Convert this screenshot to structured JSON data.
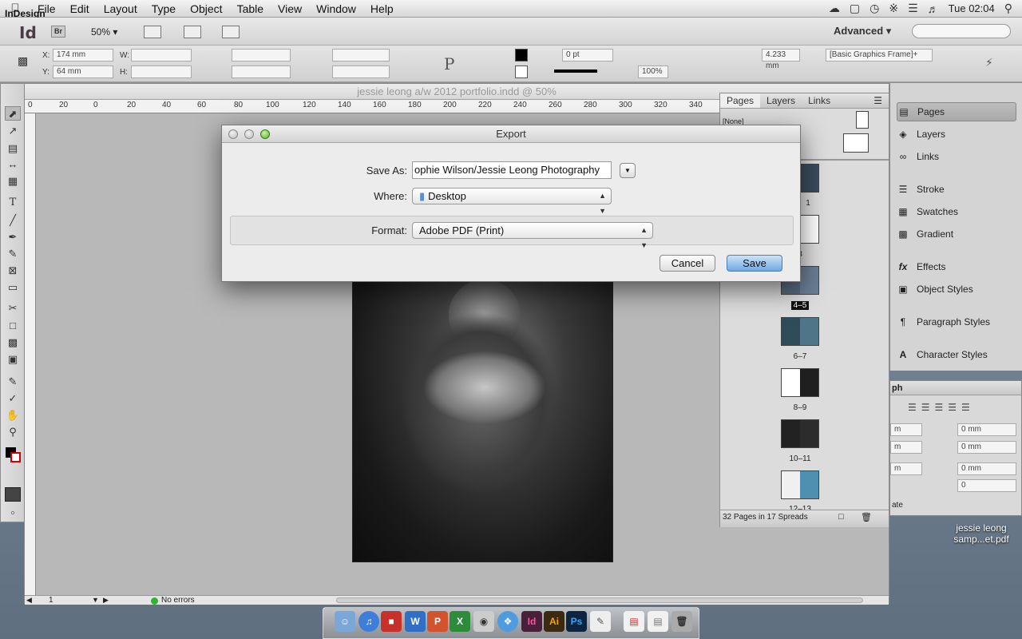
{
  "menubar": {
    "app_name": "InDesign",
    "menus": [
      "File",
      "Edit",
      "Layout",
      "Type",
      "Object",
      "Table",
      "View",
      "Window",
      "Help"
    ],
    "clock": "Tue 02:04"
  },
  "appbar": {
    "logo": "Id",
    "bridge": "Br",
    "zoom": "50%",
    "workspace": "Advanced"
  },
  "control": {
    "x_label": "X:",
    "x_value": "174 mm",
    "y_label": "Y:",
    "y_value": "64 mm",
    "w_label": "W:",
    "h_label": "H:",
    "stroke_weight": "0 pt",
    "opacity": "100%",
    "spacing": "4.233 mm",
    "object_style": "[Basic Graphics Frame]+"
  },
  "document": {
    "title": "jessie leong a/w 2012 portfolio.indd @ 50%",
    "ruler_ticks": [
      "0",
      "20",
      "0",
      "20",
      "40",
      "60",
      "80",
      "100",
      "120",
      "140",
      "160",
      "180",
      "200",
      "220",
      "240",
      "260",
      "280",
      "300",
      "320",
      "340"
    ],
    "page_number": "1",
    "preflight": "No errors"
  },
  "pages_panel": {
    "tabs": [
      "Pages",
      "Layers",
      "Links"
    ],
    "none_label": "[None]",
    "spreads": [
      "1",
      "3",
      "4–5",
      "6–7",
      "8–9",
      "10–11",
      "12–13"
    ],
    "footer": "32 Pages in 17 Spreads"
  },
  "dock_panels": [
    "Pages",
    "Layers",
    "Links",
    "Stroke",
    "Swatches",
    "Gradient",
    "Effects",
    "Object Styles",
    "Paragraph Styles",
    "Character Styles"
  ],
  "paragraph_panel": {
    "title": "ph",
    "fields": [
      "0 mm",
      "0 mm",
      "0 mm",
      "0"
    ],
    "left_fields": [
      "m",
      "m",
      "m"
    ],
    "hyphenate": "ate"
  },
  "dialog": {
    "title": "Export",
    "save_as_label": "Save As:",
    "save_as_value": "ophie Wilson/Jessie Leong Photography",
    "where_label": "Where:",
    "where_value": "Desktop",
    "format_label": "Format:",
    "format_value": "Adobe PDF (Print)",
    "cancel": "Cancel",
    "save": "Save"
  },
  "desktop_file": {
    "line1": "jessie leong",
    "line2": "samp...et.pdf"
  },
  "colors": {
    "accent_blue": "#6fa9e3",
    "green_dot": "#2db52d"
  }
}
